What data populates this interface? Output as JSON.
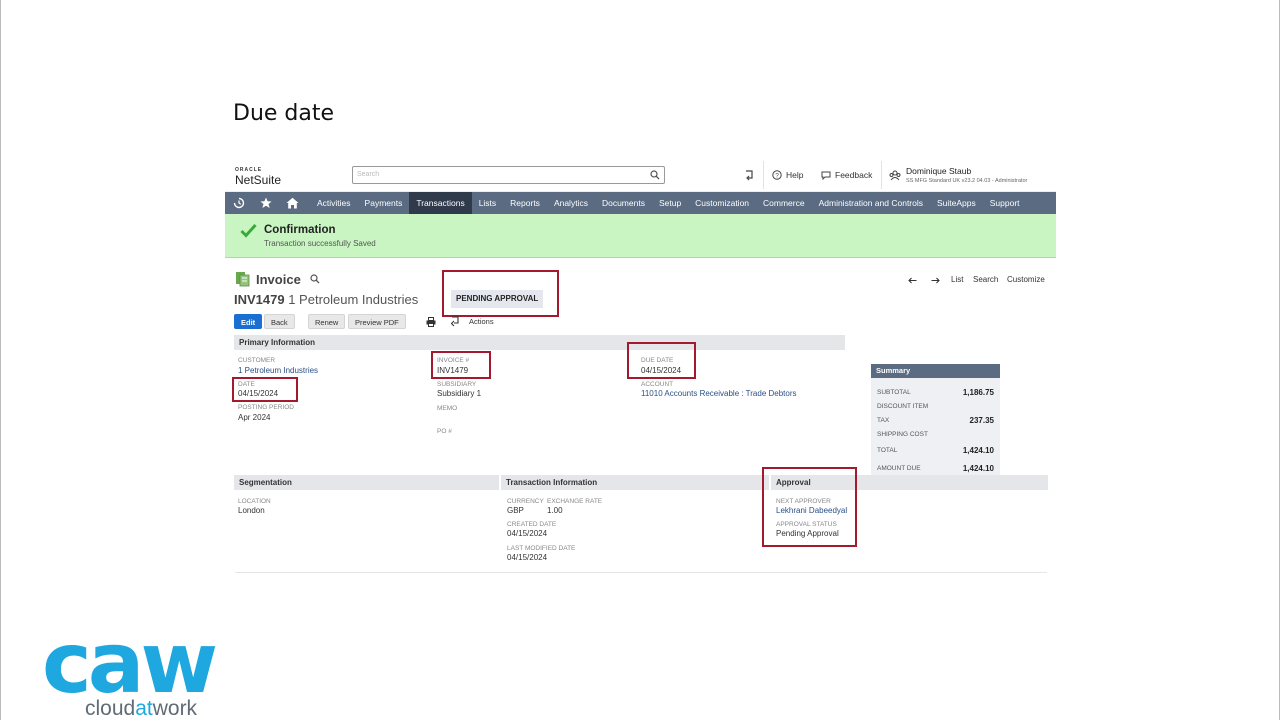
{
  "slide": {
    "title": "Due date"
  },
  "logo": {
    "oracle": "ORACLE",
    "netsuite": "NetSuite"
  },
  "search": {
    "placeholder": "Search",
    "icon": "search-icon"
  },
  "topbar": {
    "help": "Help",
    "feedback": "Feedback",
    "user_name": "Dominique Staub",
    "user_role": "SS MFG Standard UK v23.2 04.03 - Administrator"
  },
  "nav": {
    "items": [
      "Activities",
      "Payments",
      "Transactions",
      "Lists",
      "Reports",
      "Analytics",
      "Documents",
      "Setup",
      "Customization",
      "Commerce",
      "Administration and Controls",
      "SuiteApps",
      "Support"
    ],
    "active": "Transactions"
  },
  "confirmation": {
    "title": "Confirmation",
    "message": "Transaction successfully Saved"
  },
  "record": {
    "type": "Invoice",
    "number": "INV1479",
    "customer": "1 Petroleum Industries",
    "status": "PENDING APPROVAL"
  },
  "record_nav": {
    "list": "List",
    "search": "Search",
    "customize": "Customize"
  },
  "buttons": {
    "edit": "Edit",
    "back": "Back",
    "renew": "Renew",
    "preview_pdf": "Preview PDF",
    "actions": "Actions"
  },
  "primary": {
    "title": "Primary Information",
    "customer_label": "CUSTOMER",
    "customer": "1 Petroleum Industries",
    "date_label": "DATE",
    "date": "04/15/2024",
    "posting_period_label": "POSTING PERIOD",
    "posting_period": "Apr 2024",
    "invoice_label": "INVOICE #",
    "invoice": "INV1479",
    "subsidiary_label": "SUBSIDIARY",
    "subsidiary": "Subsidiary 1",
    "memo_label": "MEMO",
    "po_label": "PO #",
    "due_date_label": "DUE DATE",
    "due_date": "04/15/2024",
    "account_label": "ACCOUNT",
    "account": "11010 Accounts Receivable : Trade Debtors"
  },
  "summary": {
    "title": "Summary",
    "subtotal_label": "SUBTOTAL",
    "subtotal": "1,186.75",
    "discount_label": "DISCOUNT ITEM",
    "tax_label": "TAX",
    "tax": "237.35",
    "shipping_label": "SHIPPING COST",
    "total_label": "TOTAL",
    "total": "1,424.10",
    "amount_due_label": "AMOUNT DUE",
    "amount_due": "1,424.10"
  },
  "segmentation": {
    "title": "Segmentation",
    "location_label": "LOCATION",
    "location": "London"
  },
  "transaction_info": {
    "title": "Transaction Information",
    "currency_label": "CURRENCY",
    "currency": "GBP",
    "exchange_rate_label": "EXCHANGE RATE",
    "exchange_rate": "1.00",
    "created_date_label": "CREATED DATE",
    "created_date": "04/15/2024",
    "last_modified_label": "LAST MODIFIED DATE",
    "last_modified": "04/15/2024"
  },
  "approval": {
    "title": "Approval",
    "next_approver_label": "NEXT APPROVER",
    "next_approver": "Lekhrani Dabeedyal",
    "approval_status_label": "APPROVAL STATUS",
    "approval_status": "Pending Approval"
  },
  "brand": {
    "mark": "caw",
    "word_a": "cloud",
    "word_b": "at",
    "word_c": "work",
    "color": "#1fa8df"
  }
}
